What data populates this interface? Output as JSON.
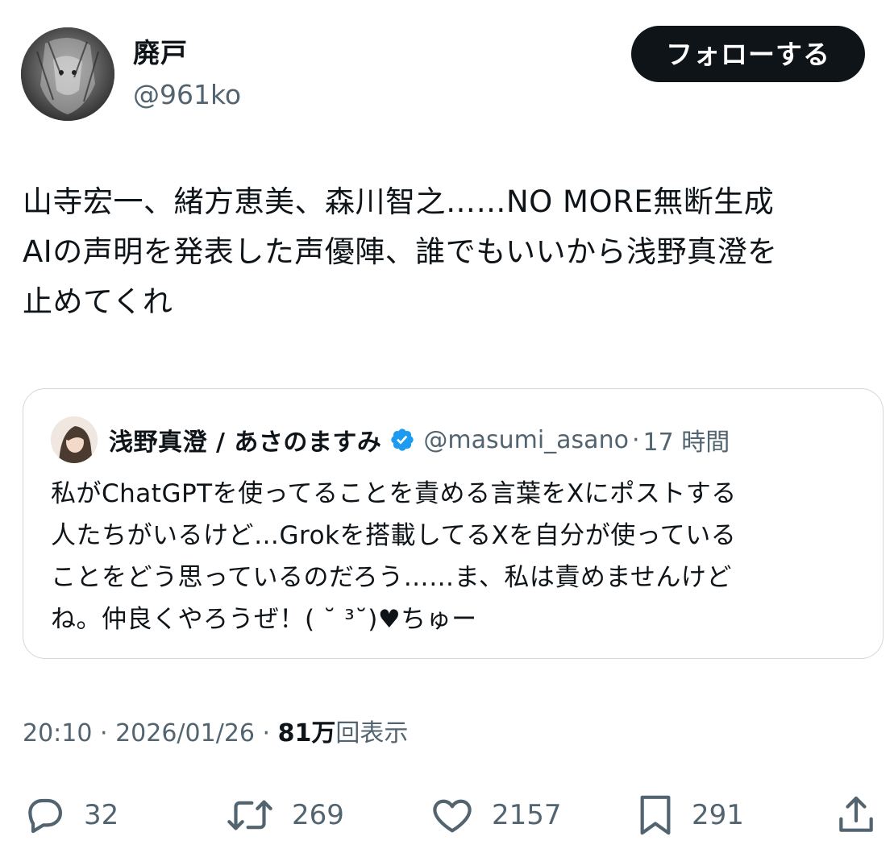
{
  "author": {
    "display_name": "廃戸",
    "handle": "@961ko",
    "avatar_icon": "avatar-image"
  },
  "follow_button_label": "フォローする",
  "tweet_text": "山寺宏一、緒方恵美、森川智之……NO MORE無断生成\nAIの声明を発表した声優陣、誰でもいいから浅野真澄を\n止めてくれ",
  "quote": {
    "display_name": "浅野真澄 / あさのますみ",
    "handle": "@masumi_asano",
    "separator": "·",
    "time": "17 時間",
    "text": "私がChatGPTを使ってることを責める言葉をXにポストする\n人たちがいるけど…Grokを搭載してるXを自分が使っている\nことをどう思っているのだろう……ま、私は責めませんけど\nね。仲良くやろうぜ！( ˘ ³˘)♥︎ちゅー",
    "verified_color": "#1d9bf0"
  },
  "meta": {
    "time": "20:10",
    "sep1": " · ",
    "date": "2026/01/26",
    "sep2": " · ",
    "views_count": "81万",
    "views_label": "回表示"
  },
  "actions": {
    "replies": "32",
    "reposts": "269",
    "likes": "2157",
    "bookmarks": "291"
  },
  "colors": {
    "text": "#0f1419",
    "secondary": "#536471",
    "border": "#cfd9de",
    "button_bg": "#0f1419"
  }
}
